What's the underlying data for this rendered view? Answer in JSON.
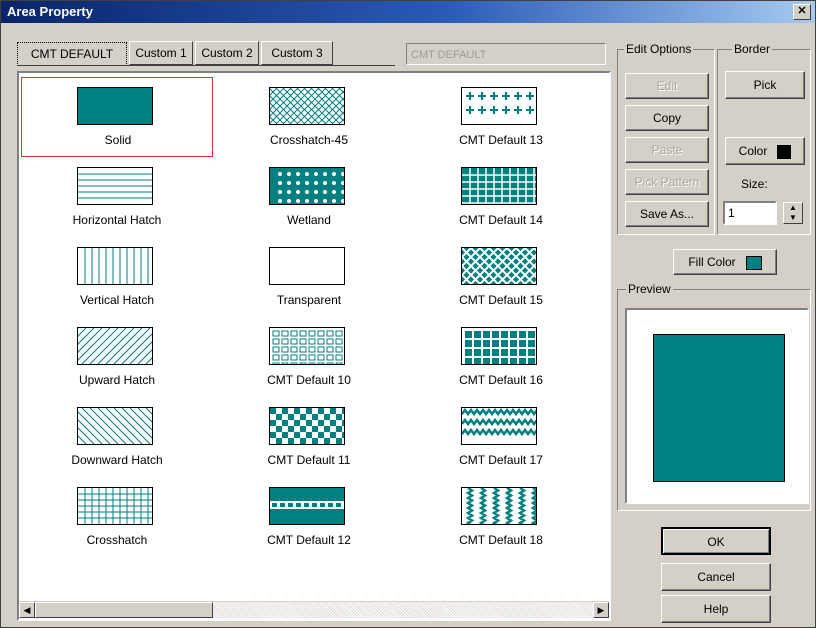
{
  "window": {
    "title": "Area Property",
    "close_glyph": "✕"
  },
  "tabs": [
    {
      "label": "CMT DEFAULT",
      "active": true
    },
    {
      "label": "Custom 1"
    },
    {
      "label": "Custom 2"
    },
    {
      "label": "Custom 3"
    }
  ],
  "pattern_name_field": {
    "value": "CMT DEFAULT"
  },
  "patterns": [
    {
      "label": "Solid",
      "pattern": "solid",
      "selected": true
    },
    {
      "label": "Crosshatch-45",
      "pattern": "crosshatch-45"
    },
    {
      "label": "CMT Default 13",
      "pattern": "plus-marks"
    },
    {
      "label": "Horizontal Hatch",
      "pattern": "horizontal-hatch"
    },
    {
      "label": "Wetland",
      "pattern": "dots"
    },
    {
      "label": "CMT Default 14",
      "pattern": "dense-grid"
    },
    {
      "label": "Vertical Hatch",
      "pattern": "vertical-hatch"
    },
    {
      "label": "Transparent",
      "pattern": "transparent"
    },
    {
      "label": "CMT Default 15",
      "pattern": "diamond-lattice"
    },
    {
      "label": "Upward Hatch",
      "pattern": "upward-hatch"
    },
    {
      "label": "CMT Default 10",
      "pattern": "small-squares"
    },
    {
      "label": "CMT Default 16",
      "pattern": "square-grid"
    },
    {
      "label": "Downward Hatch",
      "pattern": "downward-hatch"
    },
    {
      "label": "CMT Default 11",
      "pattern": "checker"
    },
    {
      "label": "CMT Default 17",
      "pattern": "zigzag"
    },
    {
      "label": "Crosshatch",
      "pattern": "crosshatch"
    },
    {
      "label": "CMT Default 12",
      "pattern": "dashed-band"
    },
    {
      "label": "CMT Default 18",
      "pattern": "vertical-zigzag"
    }
  ],
  "edit_options": {
    "title": "Edit Options",
    "edit": "Edit",
    "copy": "Copy",
    "paste": "Paste",
    "pick_pattern": "Pick Pattern",
    "save_as": "Save As..."
  },
  "border": {
    "title": "Border",
    "pick": "Pick",
    "color_label": "Color",
    "color": "#000000",
    "size_label": "Size:",
    "size_value": "1"
  },
  "fill_color": {
    "label": "Fill Color",
    "color": "#008080"
  },
  "preview": {
    "title": "Preview",
    "color": "#008080"
  },
  "buttons": {
    "ok": "OK",
    "cancel": "Cancel",
    "help": "Help"
  },
  "scrollbar": {
    "left_glyph": "◀",
    "right_glyph": "▶"
  },
  "spinner": {
    "up_glyph": "▲",
    "down_glyph": "▼"
  },
  "colors": {
    "teal": "#008080",
    "selection_border": "#e03030"
  }
}
